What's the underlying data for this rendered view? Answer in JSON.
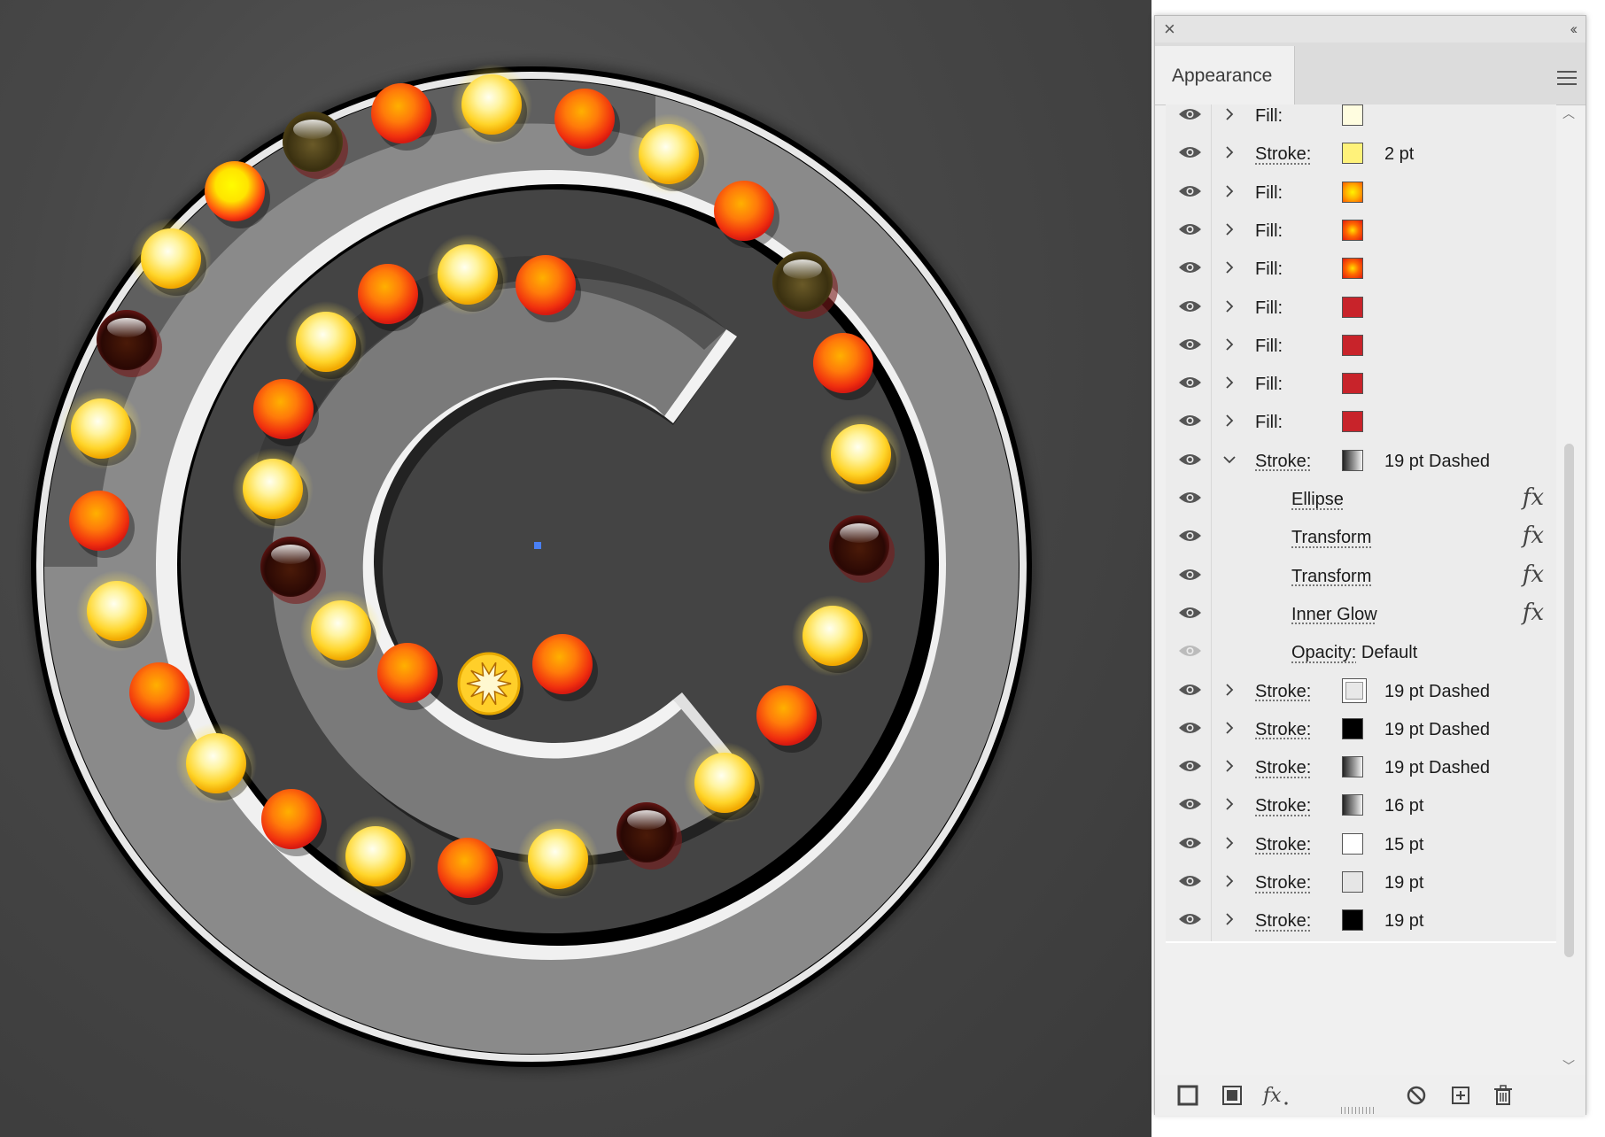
{
  "panel": {
    "title": "Appearance",
    "close_icon": "close-icon",
    "collapse_icon": "collapse-chevrons-icon",
    "menu_icon": "hamburger-menu-icon"
  },
  "rows": [
    {
      "kind": "attr",
      "label": "Fill:",
      "link": false,
      "swatch": "#fffde0",
      "swatch_type": "fill",
      "value": "",
      "expanded": false
    },
    {
      "kind": "attr",
      "label": "Stroke:",
      "link": true,
      "swatch": "#fff27a",
      "swatch_type": "fill",
      "value": "2 pt",
      "expanded": false
    },
    {
      "kind": "attr",
      "label": "Fill:",
      "link": false,
      "swatch": "radial-yellow-orange",
      "swatch_type": "fill",
      "value": "",
      "expanded": false
    },
    {
      "kind": "attr",
      "label": "Fill:",
      "link": false,
      "swatch": "radial-orange-red",
      "swatch_type": "fill",
      "value": "",
      "expanded": false
    },
    {
      "kind": "attr",
      "label": "Fill:",
      "link": false,
      "swatch": "radial-orange-red",
      "swatch_type": "fill",
      "value": "",
      "expanded": false
    },
    {
      "kind": "attr",
      "label": "Fill:",
      "link": false,
      "swatch": "#c8232a",
      "swatch_type": "fill",
      "value": "",
      "expanded": false
    },
    {
      "kind": "attr",
      "label": "Fill:",
      "link": false,
      "swatch": "#c8232a",
      "swatch_type": "fill",
      "value": "",
      "expanded": false
    },
    {
      "kind": "attr",
      "label": "Fill:",
      "link": false,
      "swatch": "#c8232a",
      "swatch_type": "fill",
      "value": "",
      "expanded": false
    },
    {
      "kind": "attr",
      "label": "Fill:",
      "link": false,
      "swatch": "#c8232a",
      "swatch_type": "fill",
      "value": "",
      "expanded": false
    },
    {
      "kind": "attr",
      "label": "Stroke:",
      "link": true,
      "swatch": "gradient-gray",
      "swatch_type": "fill",
      "value": "19 pt Dashed",
      "expanded": true
    },
    {
      "kind": "effect",
      "label": "Ellipse"
    },
    {
      "kind": "effect",
      "label": "Transform"
    },
    {
      "kind": "effect",
      "label": "Transform"
    },
    {
      "kind": "effect",
      "label": "Inner Glow"
    },
    {
      "kind": "opacity",
      "label": "Opacity:",
      "value": "Default"
    },
    {
      "kind": "attr",
      "label": "Stroke:",
      "link": true,
      "swatch": "#e8e8e8",
      "swatch_type": "stroke",
      "value": "19 pt Dashed",
      "expanded": false
    },
    {
      "kind": "attr",
      "label": "Stroke:",
      "link": true,
      "swatch": "#000000",
      "swatch_type": "fill",
      "value": "19 pt Dashed",
      "expanded": false
    },
    {
      "kind": "attr",
      "label": "Stroke:",
      "link": true,
      "swatch": "gradient-gray",
      "swatch_type": "fill",
      "value": "19 pt Dashed",
      "expanded": false
    },
    {
      "kind": "attr",
      "label": "Stroke:",
      "link": true,
      "swatch": "gradient-gray",
      "swatch_type": "fill",
      "value": "16 pt",
      "expanded": false
    },
    {
      "kind": "attr",
      "label": "Stroke:",
      "link": true,
      "swatch": "#ffffff",
      "swatch_type": "fill",
      "value": "15 pt",
      "expanded": false
    },
    {
      "kind": "attr",
      "label": "Stroke:",
      "link": true,
      "swatch": "#e6e6e6",
      "swatch_type": "fill",
      "value": "19 pt",
      "expanded": false
    },
    {
      "kind": "attr",
      "label": "Stroke:",
      "link": true,
      "swatch": "#000000",
      "swatch_type": "fill",
      "value": "19 pt",
      "expanded": false
    }
  ],
  "footer": {
    "icons": [
      "add-new-stroke-icon",
      "add-new-fill-icon",
      "fx-menu-icon",
      "clear-appearance-icon",
      "duplicate-item-icon",
      "delete-item-icon"
    ]
  },
  "canvas": {
    "background": "#474747",
    "bulb_colors": {
      "yellow": "#ffe35a",
      "orange": "#ff6a0e",
      "dark": "#2a0a05",
      "bright": "#ffee00"
    }
  }
}
